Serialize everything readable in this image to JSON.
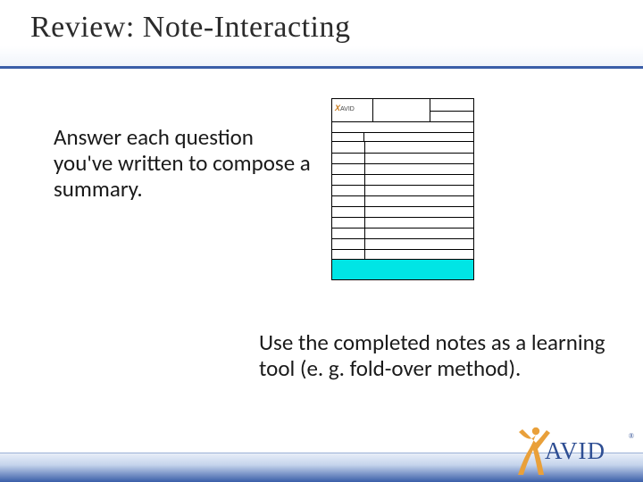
{
  "title": "Review: Note-Interacting",
  "body": {
    "paragraph1": "Answer each question you've written to compose a summary.",
    "paragraph2": "Use the completed notes as a learning tool (e. g. fold-over method)."
  },
  "thumbnail": {
    "logo_text": "AVID",
    "labels": {
      "topic": "",
      "name": "",
      "date": "",
      "questions": "",
      "notes": "",
      "summary": ""
    },
    "highlight_color": "#00e5e5"
  },
  "logo": {
    "text": "AVID",
    "registered": "®"
  },
  "colors": {
    "accent": "#3a5ea8",
    "figure": "#e9a03a"
  }
}
